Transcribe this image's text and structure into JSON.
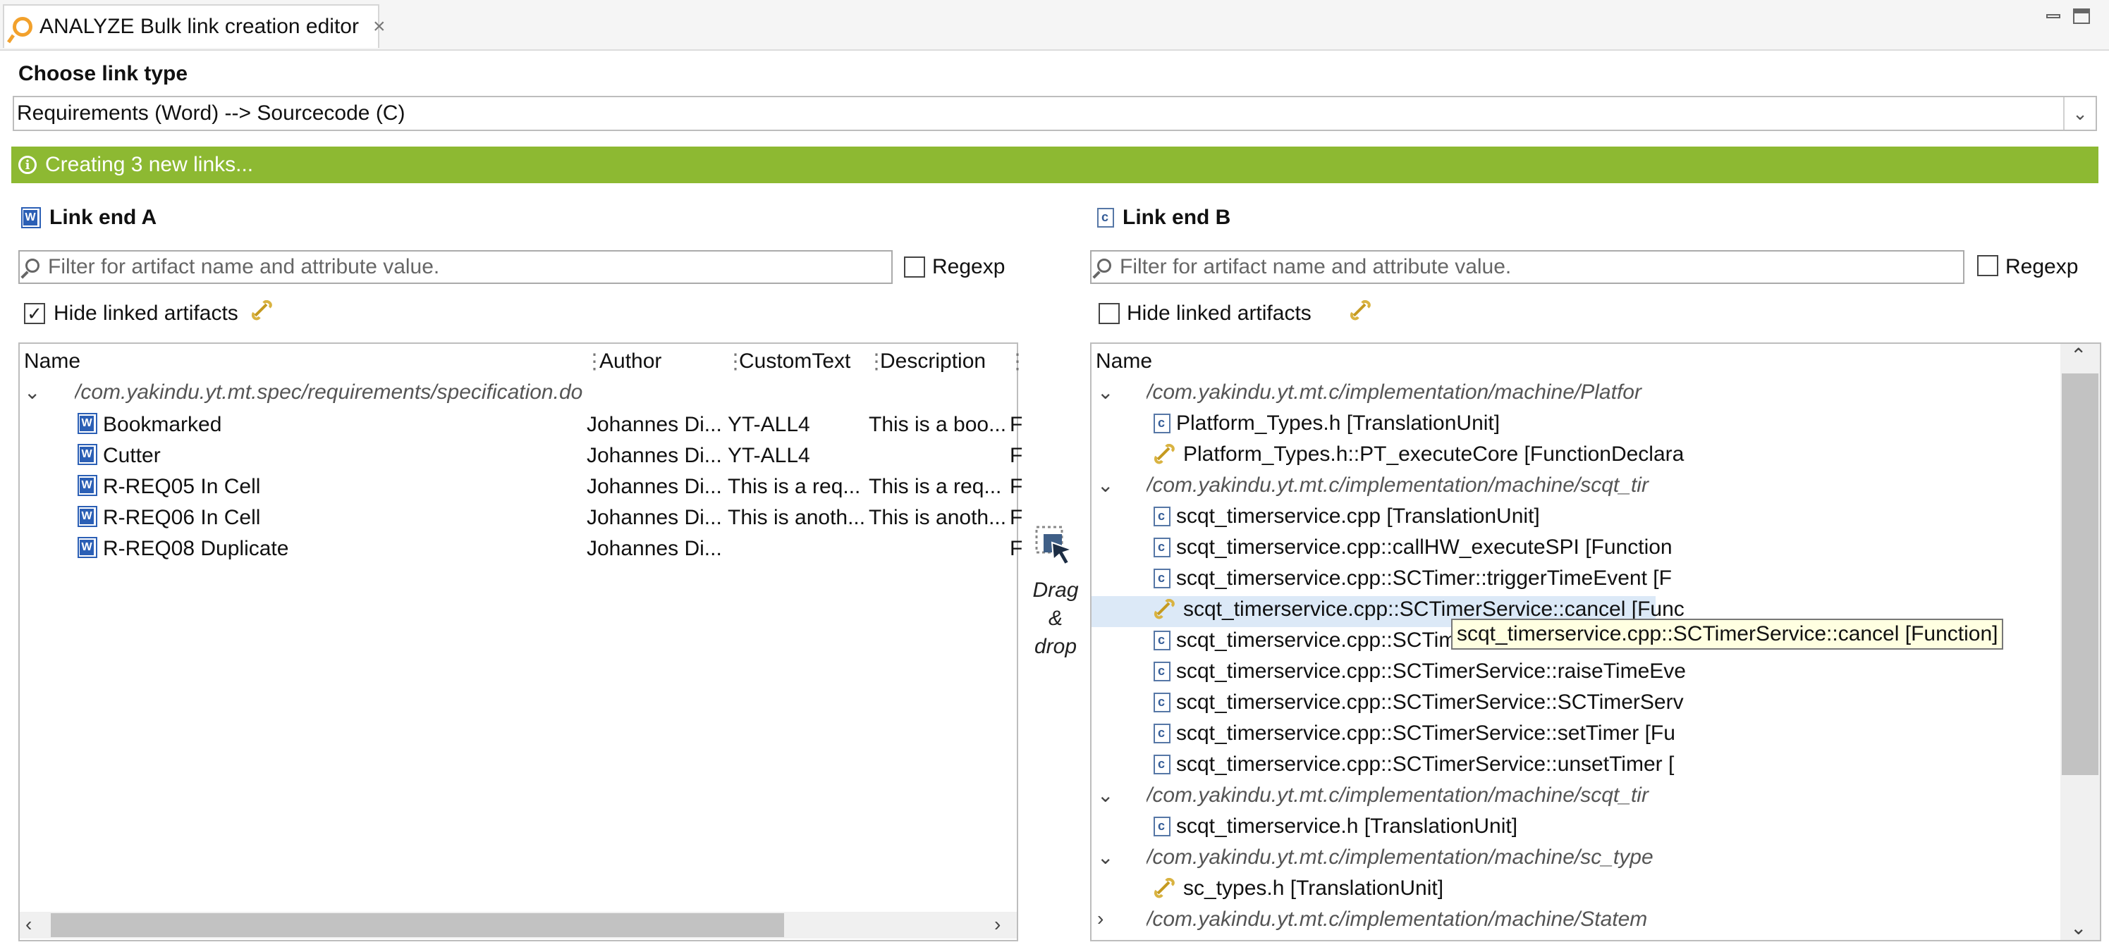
{
  "window": {
    "title": "ANALYZE Bulk link creation editor",
    "close_glyph": "×",
    "icons": [
      "analyze-icon",
      "minimize-icon",
      "maximize-icon"
    ]
  },
  "link_type": {
    "title": "Choose link type",
    "selected": "Requirements (Word) --> Sourcecode (C)"
  },
  "status": {
    "message": "Creating 3 new links...",
    "icon": "info-icon",
    "color": "#8db932"
  },
  "drag_drop": {
    "line1": "Drag",
    "line2": "&",
    "line3": "drop"
  },
  "link_end_a": {
    "title": "Link end A",
    "filter_placeholder": "Filter for artifact name and attribute value.",
    "regexp_label": "Regexp",
    "hide_linked_label": "Hide linked artifacts",
    "hide_linked_checked": true,
    "columns": [
      "Name",
      "Author",
      "CustomText",
      "Description"
    ],
    "root": "/com.yakindu.yt.mt.spec/requirements/specification.doc",
    "rows": [
      {
        "name": "Bookmarked",
        "author": "Johannes Di...",
        "custom": "YT-ALL4",
        "desc": "This is a boo...",
        "extra": "F"
      },
      {
        "name": "Cutter",
        "author": "Johannes Di...",
        "custom": "YT-ALL4",
        "desc": "",
        "extra": "F"
      },
      {
        "name": "R-REQ05 In Cell",
        "author": "Johannes Di...",
        "custom": "This is a req...",
        "desc": "This is a req...",
        "extra": "F"
      },
      {
        "name": "R-REQ06 In Cell",
        "author": "Johannes Di...",
        "custom": "This is anoth...",
        "desc": "This is anoth...",
        "extra": "F"
      },
      {
        "name": "R-REQ08 Duplicate",
        "author": "Johannes Di...",
        "custom": "",
        "desc": "",
        "extra": "F"
      }
    ]
  },
  "link_end_b": {
    "title": "Link end B",
    "filter_placeholder": "Filter for artifact name and attribute value.",
    "regexp_label": "Regexp",
    "hide_linked_label": "Hide linked artifacts",
    "hide_linked_checked": false,
    "column": "Name",
    "rows": [
      {
        "type": "folder",
        "text": "/com.yakindu.yt.mt.c/implementation/machine/Platfor",
        "expanded": true
      },
      {
        "type": "c",
        "text": "Platform_Types.h [TranslationUnit]"
      },
      {
        "type": "link",
        "text": "Platform_Types.h::PT_executeCore [FunctionDeclara"
      },
      {
        "type": "folder",
        "text": "/com.yakindu.yt.mt.c/implementation/machine/scqt_tir",
        "expanded": true
      },
      {
        "type": "c",
        "text": "scqt_timerservice.cpp [TranslationUnit]"
      },
      {
        "type": "c",
        "text": "scqt_timerservice.cpp::callHW_executeSPI [Function"
      },
      {
        "type": "c",
        "text": "scqt_timerservice.cpp::SCTimer::triggerTimeEvent [F"
      },
      {
        "type": "link",
        "text": "scqt_timerservice.cpp::SCTimerService::cancel [Func",
        "selected": true
      },
      {
        "type": "c",
        "text": "scqt_timerservice.cpp::SCTime"
      },
      {
        "type": "c",
        "text": "scqt_timerservice.cpp::SCTimerService::raiseTimeEve"
      },
      {
        "type": "c",
        "text": "scqt_timerservice.cpp::SCTimerService::SCTimerServ"
      },
      {
        "type": "c",
        "text": "scqt_timerservice.cpp::SCTimerService::setTimer [Fu"
      },
      {
        "type": "c",
        "text": "scqt_timerservice.cpp::SCTimerService::unsetTimer ["
      },
      {
        "type": "folder",
        "text": "/com.yakindu.yt.mt.c/implementation/machine/scqt_tir",
        "expanded": true
      },
      {
        "type": "c",
        "text": "scqt_timerservice.h [TranslationUnit]"
      },
      {
        "type": "folder",
        "text": "/com.yakindu.yt.mt.c/implementation/machine/sc_type",
        "expanded": true
      },
      {
        "type": "link",
        "text": "sc_types.h [TranslationUnit]"
      },
      {
        "type": "folder",
        "text": "/com.yakindu.yt.mt.c/implementation/machine/Statem",
        "expanded": false
      }
    ],
    "tooltip": "scqt_timerservice.cpp::SCTimerService::cancel [Function]"
  }
}
